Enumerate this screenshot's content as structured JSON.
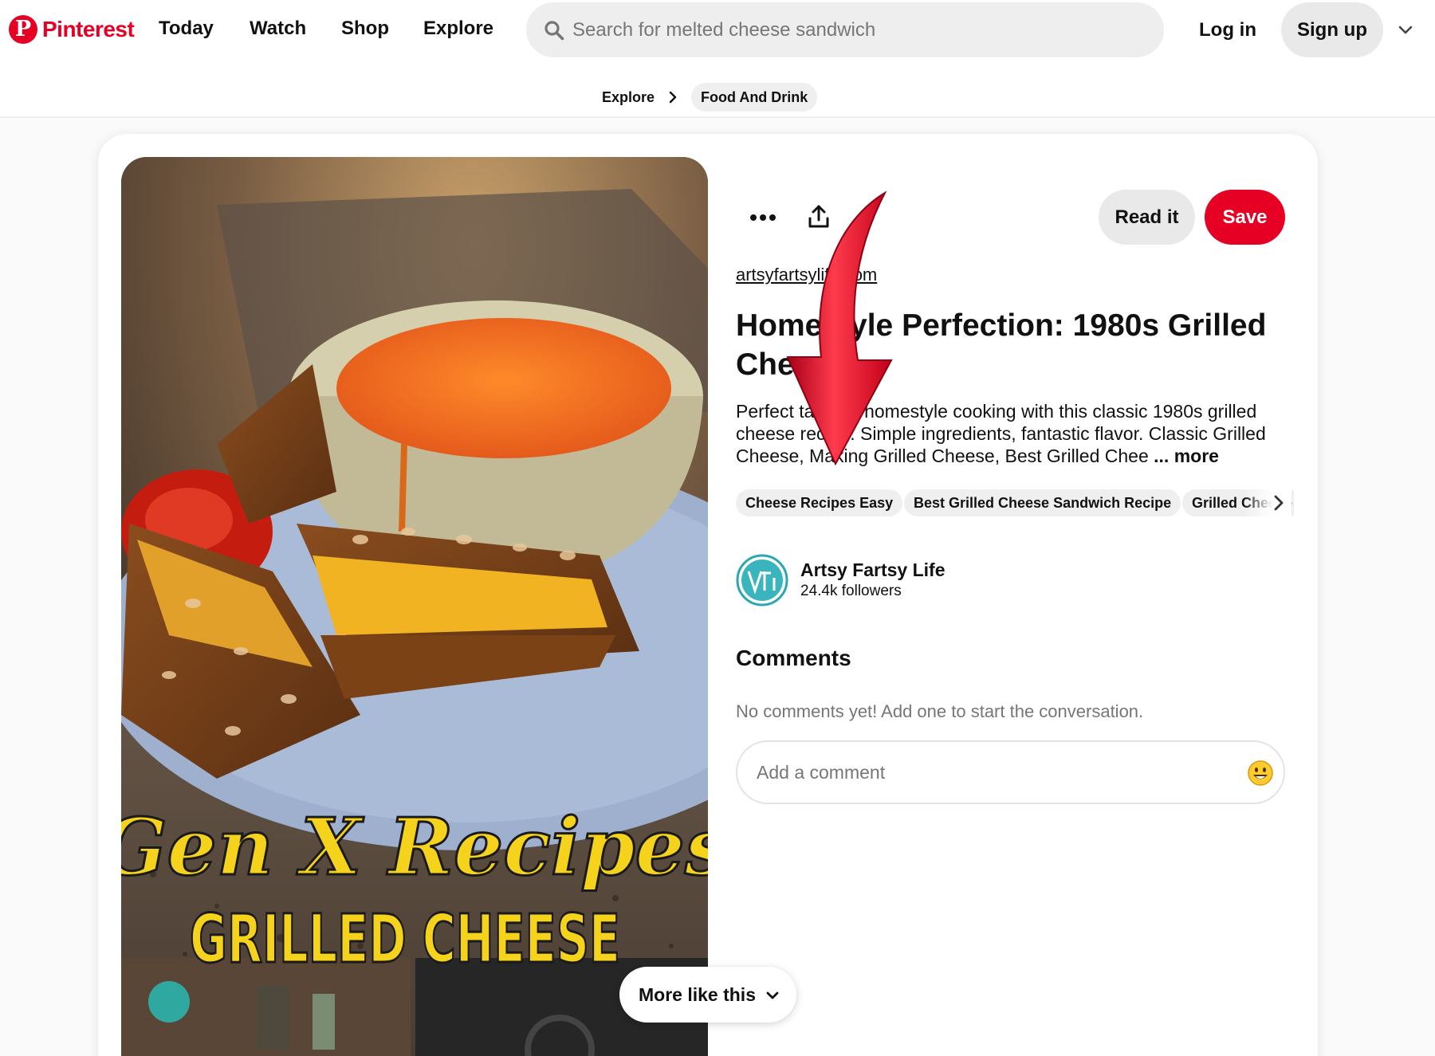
{
  "header": {
    "brand": "Pinterest",
    "nav": [
      "Today",
      "Watch",
      "Shop",
      "Explore"
    ],
    "search_placeholder": "Search for melted cheese sandwich",
    "login_label": "Log in",
    "signup_label": "Sign up"
  },
  "breadcrumb": {
    "items": [
      "Explore",
      "Food And Drink"
    ]
  },
  "pin": {
    "image_text": {
      "line1": "Gen X Recipes",
      "line2": "GRILLED CHEESE"
    },
    "read_label": "Read it",
    "save_label": "Save",
    "source": "artsyfartsylife.com",
    "title": "Homestyle Perfection: 1980s Grilled Cheese",
    "description": "Perfect taste of homestyle cooking with this classic 1980s grilled cheese recipe. Simple ingredients, fantastic flavor. Classic Grilled Cheese, Making Grilled Cheese, Best Grilled Chee",
    "more_label": "... more",
    "tags": [
      "Cheese Recipes Easy",
      "Best Grilled Cheese Sandwich Recipe",
      "Grilled Cheese"
    ]
  },
  "author": {
    "name": "Artsy Fartsy Life",
    "followers": "24.4k followers"
  },
  "comments": {
    "title": "Comments",
    "empty_text": "No comments yet! Add one to start the conversation.",
    "input_placeholder": "Add a comment"
  },
  "more_like_label": "More like this",
  "colors": {
    "brand_red": "#e60023",
    "chip_gray": "#efefef",
    "arrow_red": "#d8102a"
  },
  "icons": [
    "search-icon",
    "chevron-down-icon",
    "chevron-right-icon",
    "more-dots-icon",
    "share-icon",
    "smiley-emoji-icon"
  ]
}
